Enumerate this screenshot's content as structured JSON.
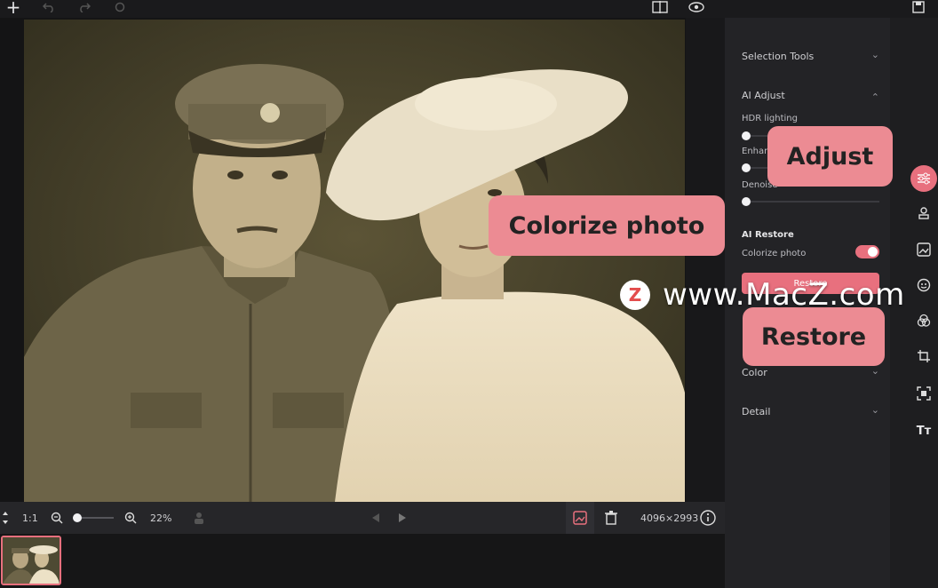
{
  "colors": {
    "accent": "#e8707e",
    "callout": "#ec8b93",
    "panel": "#232326"
  },
  "topbar": {
    "icons": [
      "plus-icon",
      "undo-icon",
      "redo-icon",
      "reset-icon",
      "compare-icon",
      "preview-eye-icon",
      "save-icon"
    ]
  },
  "panel": {
    "selection_tools": "Selection Tools",
    "ai_adjust": "AI Adjust",
    "hdr_lighting": "HDR lighting",
    "enhance": "Enhan",
    "denoise": "Denoise",
    "ai_restore": "AI Restore",
    "colorize_photo": "Colorize photo",
    "restore_button": "Restore",
    "color": "Color",
    "detail": "Detail"
  },
  "callouts": {
    "adjust": "Adjust",
    "colorize": "Colorize photo",
    "restore": "Restore"
  },
  "watermark": {
    "logo_letter": "Z",
    "text": "www.MacZ.com"
  },
  "bottombar": {
    "fit": "1:1",
    "zoom": "22%",
    "dimensions": "4096×2993"
  },
  "sliders": {
    "hdr_lighting": 0,
    "enhance": 0,
    "denoise": 0
  },
  "toggles": {
    "colorize_photo": true
  }
}
